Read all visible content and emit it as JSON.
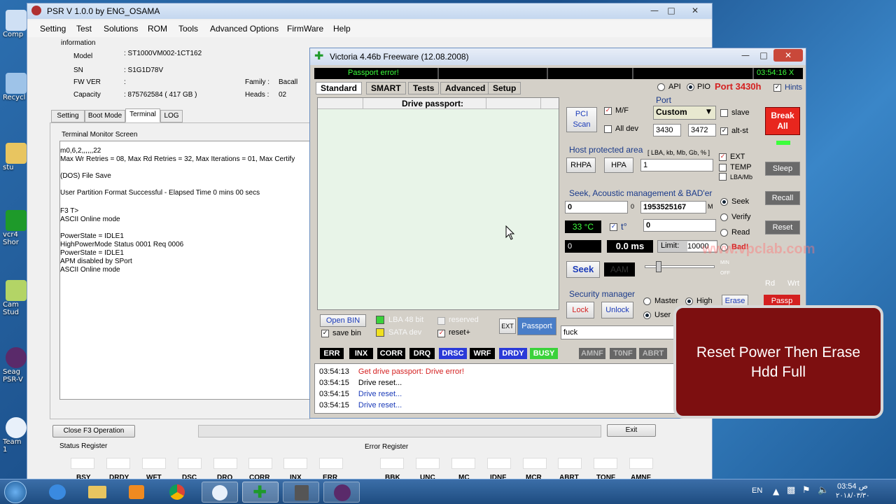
{
  "desktop": {
    "icons": [
      {
        "label": "Comp",
        "icon": "computer-icon"
      },
      {
        "label": "Recycl",
        "icon": "recycle-bin-icon"
      },
      {
        "label": "stu",
        "icon": "folder-icon"
      },
      {
        "label": "vcr4\nShor",
        "icon": "victoria-shortcut-icon"
      },
      {
        "label": "Cam\nStud",
        "icon": "camtasia-icon"
      },
      {
        "label": "Seag\nPSR-V",
        "icon": "seagate-psr-icon"
      },
      {
        "label": "Team\n1",
        "icon": "teamviewer-icon"
      }
    ]
  },
  "psr": {
    "title": "PSR V 1.0.0  by ENG_OSAMA",
    "menu": [
      "Setting",
      "Test",
      "Solutions",
      "ROM",
      "Tools",
      "Advanced Options",
      "FirmWare",
      "Help"
    ],
    "info": {
      "header": "information",
      "model_label": "Model",
      "model_value": ": ST1000VM002-1CT162",
      "sn_label": "SN",
      "sn_value": ": S1G1D78V",
      "fw_label": "FW VER",
      "fw_value": ":",
      "capacity_label": "Capacity",
      "capacity_value": ": 875762584  ( 417 GB )",
      "family_label": "Family :",
      "family_value": "Bacall",
      "heads_label": "Heads :",
      "heads_value": "02"
    },
    "tabs": [
      "Setting",
      "Boot Mode",
      "Terminal",
      "LOG"
    ],
    "active_tab": "Terminal",
    "terminal_title": "Terminal Monitor Screen",
    "terminal_lines": [
      "m0,6,2,,,,,,22",
      "Max Wr Retries = 08, Max Rd Retries = 32,  Max Iterations = 01, Max Certify",
      "",
      "(DOS) File Save",
      "",
      "User Partition Format Successful - Elapsed Time 0 mins 00 secs",
      "",
      "F3 T>",
      "ASCII Online mode",
      "",
      " PowerState = IDLE1",
      " HighPowerMode Status 0001 Req 0006",
      " PowerState = IDLE1",
      " APM disabled by SPort",
      "ASCII Online mode"
    ],
    "close_f3_label": "Close F3 Operation",
    "exit_label": "Exit",
    "status_register_label": "Status Register",
    "status_bits": [
      "BSY",
      "DRDY",
      "WFT",
      "DSC",
      "DRQ",
      "CORR",
      "INX",
      "ERR"
    ],
    "error_register_label": "Error Register",
    "error_bits": [
      "BBK",
      "UNC",
      "MC",
      "IDNF",
      "MCR",
      "ABRT",
      "TONF",
      "AMNF"
    ]
  },
  "victoria": {
    "title": "Victoria 4.46b Freeware (12.08.2008)",
    "status_error": "Passport error!",
    "clock": "03:54:16 X",
    "tabs": [
      "Standard",
      "SMART",
      "Tests",
      "Advanced",
      "Setup"
    ],
    "api_label": "API",
    "pio_label": "PIO",
    "port_label": "Port 3430h",
    "hints_label": "Hints",
    "passport_header": "Drive passport:",
    "pci_scan_label": "PCI\nScan",
    "mf_label": "M/F",
    "alldev_label": "All dev",
    "port_group": "Port",
    "port_select": "Custom",
    "slave_label": "slave",
    "port1": "3430",
    "port2": "3472",
    "altst_label": "alt-st",
    "break_all_label": "Break\nAll",
    "sleep_label": "Sleep",
    "recall_label": "Recall",
    "reset_label": "Reset",
    "rd_label": "Rd",
    "wrt_label": "Wrt",
    "passp_label": "Passp",
    "hpa_section": "Host protected area",
    "hpa_units": "[ LBA, kb, Mb, Gb, % ]",
    "rhpa_label": "RHPA",
    "hpa_label": "HPA",
    "hpa_value": "1",
    "ext_label": "EXT",
    "temp_label": "TEMP",
    "lbamb_label": "LBA/Mb",
    "seek_section": "Seek, Acoustic management & BAD'er",
    "seek_start": "0",
    "seek_start_unit": "0",
    "seek_end": "1953525167",
    "seek_end_unit": "M",
    "temp_value": "33 °C",
    "t_label": "t°",
    "seek_val2": "0",
    "seek_val3": "0",
    "ms_value": "0.0 ms",
    "limit_label": "Limit:",
    "limit_value": "10000",
    "seek_button": "Seek",
    "aam_label": "AAM",
    "min_label": "MIN",
    "off_label": "OFF",
    "mode_seek": "Seek",
    "mode_verify": "Verify",
    "mode_read": "Read",
    "mode_bad": "Bad!",
    "security_section": "Security manager",
    "lock_label": "Lock",
    "unlock_label": "Unlock",
    "master_label": "Master",
    "high_label": "High",
    "user_label": "User",
    "erase_label": "Erase",
    "password_value": "fuck",
    "open_bin_label": "Open BIN",
    "save_bin_label": "save bin",
    "lba48_label": "LBA 48 bit",
    "reserved_label": "reserved",
    "sata_label": "SATA dev",
    "resetplus_label": "reset+",
    "ext_button": "EXT",
    "passport_button": "Passport",
    "flags": [
      "ERR",
      "INX",
      "CORR",
      "DRQ",
      "DRSC",
      "WRF",
      "DRDY",
      "BUSY"
    ],
    "flags_right": [
      "AMNF",
      "T0NF",
      "ABRT"
    ],
    "log": [
      {
        "time": "03:54:13",
        "text": "Get drive passport: Drive error!",
        "color": "#d42020"
      },
      {
        "time": "03:54:15",
        "text": "Drive reset...",
        "color": "#000000"
      },
      {
        "time": "03:54:15",
        "text": "Drive reset...",
        "color": "#1a3ab8"
      },
      {
        "time": "03:54:15",
        "text": "Drive reset...",
        "color": "#1a3ab8"
      }
    ],
    "watermark": "www.vpclab.com"
  },
  "overlay": {
    "line1": "Reset Power Then Erase",
    "line2": "Hdd Full"
  },
  "taskbar": {
    "lang": "EN",
    "time": "03:54 ص",
    "date": "٢٠١٨/٠٣/٣٠"
  },
  "colors": {
    "accent_red": "#e01b1b",
    "overlay_bg": "#7d0f10",
    "temp_green": "#3cff3c",
    "busy_green": "#3ad23a",
    "drsc_blue": "#2a3ad8"
  }
}
